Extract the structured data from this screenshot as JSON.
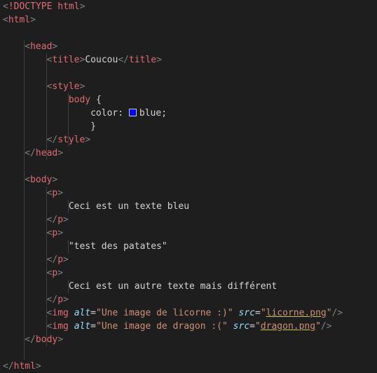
{
  "editor": {
    "lines": [
      {
        "indent": 0,
        "tokens": [
          {
            "t": "<",
            "c": "punct"
          },
          {
            "t": "!DOCTYPE html",
            "c": "red"
          },
          {
            "t": ">",
            "c": "punct"
          }
        ]
      },
      {
        "indent": 0,
        "tokens": [
          {
            "t": "<",
            "c": "punct"
          },
          {
            "t": "html",
            "c": "red"
          },
          {
            "t": ">",
            "c": "punct"
          }
        ]
      },
      {
        "indent": 0,
        "tokens": []
      },
      {
        "indent": 4,
        "tokens": [
          {
            "t": "<",
            "c": "punct"
          },
          {
            "t": "head",
            "c": "red"
          },
          {
            "t": ">",
            "c": "punct"
          }
        ]
      },
      {
        "indent": 8,
        "tokens": [
          {
            "t": "<",
            "c": "punct"
          },
          {
            "t": "title",
            "c": "red"
          },
          {
            "t": ">",
            "c": "punct"
          },
          {
            "t": "Coucou",
            "c": "plain"
          },
          {
            "t": "</",
            "c": "punct"
          },
          {
            "t": "title",
            "c": "red"
          },
          {
            "t": ">",
            "c": "punct"
          }
        ]
      },
      {
        "indent": 0,
        "tokens": []
      },
      {
        "indent": 8,
        "tokens": [
          {
            "t": "<",
            "c": "punct"
          },
          {
            "t": "style",
            "c": "red"
          },
          {
            "t": ">",
            "c": "punct"
          }
        ]
      },
      {
        "indent": 12,
        "tokens": [
          {
            "t": "body",
            "c": "red"
          },
          {
            "t": " {",
            "c": "plain"
          }
        ]
      },
      {
        "indent": 16,
        "tokens": [
          {
            "t": "color",
            "c": "plain"
          },
          {
            "t": ": ",
            "c": "plain"
          },
          {
            "t": "",
            "c": "swatch"
          },
          {
            "t": "blue",
            "c": "plain"
          },
          {
            "t": ";",
            "c": "plain"
          }
        ]
      },
      {
        "indent": 16,
        "tokens": [
          {
            "t": "}",
            "c": "plain"
          }
        ]
      },
      {
        "indent": 8,
        "tokens": [
          {
            "t": "</",
            "c": "punct"
          },
          {
            "t": "style",
            "c": "red"
          },
          {
            "t": ">",
            "c": "punct"
          }
        ]
      },
      {
        "indent": 4,
        "tokens": [
          {
            "t": "</",
            "c": "punct"
          },
          {
            "t": "head",
            "c": "red"
          },
          {
            "t": ">",
            "c": "punct"
          }
        ]
      },
      {
        "indent": 0,
        "tokens": []
      },
      {
        "indent": 4,
        "tokens": [
          {
            "t": "<",
            "c": "punct"
          },
          {
            "t": "body",
            "c": "red"
          },
          {
            "t": ">",
            "c": "punct"
          }
        ]
      },
      {
        "indent": 8,
        "tokens": [
          {
            "t": "<",
            "c": "punct"
          },
          {
            "t": "p",
            "c": "red"
          },
          {
            "t": ">",
            "c": "punct"
          }
        ]
      },
      {
        "indent": 12,
        "tokens": [
          {
            "t": "Ceci est un texte bleu",
            "c": "plain"
          }
        ]
      },
      {
        "indent": 8,
        "tokens": [
          {
            "t": "</",
            "c": "punct"
          },
          {
            "t": "p",
            "c": "red"
          },
          {
            "t": ">",
            "c": "punct"
          }
        ]
      },
      {
        "indent": 8,
        "tokens": [
          {
            "t": "<",
            "c": "punct"
          },
          {
            "t": "p",
            "c": "red"
          },
          {
            "t": ">",
            "c": "punct"
          }
        ]
      },
      {
        "indent": 12,
        "tokens": [
          {
            "t": "\"test des patates\"",
            "c": "plain"
          }
        ]
      },
      {
        "indent": 8,
        "tokens": [
          {
            "t": "</",
            "c": "punct"
          },
          {
            "t": "p",
            "c": "red"
          },
          {
            "t": ">",
            "c": "punct"
          }
        ]
      },
      {
        "indent": 8,
        "tokens": [
          {
            "t": "<",
            "c": "punct"
          },
          {
            "t": "p",
            "c": "red"
          },
          {
            "t": ">",
            "c": "punct"
          }
        ]
      },
      {
        "indent": 12,
        "tokens": [
          {
            "t": "Ceci est un autre texte mais différent",
            "c": "plain"
          }
        ]
      },
      {
        "indent": 8,
        "tokens": [
          {
            "t": "</",
            "c": "punct"
          },
          {
            "t": "p",
            "c": "red"
          },
          {
            "t": ">",
            "c": "punct"
          }
        ]
      },
      {
        "indent": 8,
        "tokens": [
          {
            "t": "<",
            "c": "punct"
          },
          {
            "t": "img",
            "c": "red"
          },
          {
            "t": " ",
            "c": "plain"
          },
          {
            "t": "alt",
            "c": "attr"
          },
          {
            "t": "=",
            "c": "plain"
          },
          {
            "t": "\"Une image de licorne :)\"",
            "c": "str"
          },
          {
            "t": " ",
            "c": "plain"
          },
          {
            "t": "src",
            "c": "attr"
          },
          {
            "t": "=",
            "c": "plain"
          },
          {
            "t": "\"",
            "c": "str"
          },
          {
            "t": "licorne.png",
            "c": "link"
          },
          {
            "t": "\"",
            "c": "str"
          },
          {
            "t": "/>",
            "c": "punct"
          }
        ]
      },
      {
        "indent": 8,
        "tokens": [
          {
            "t": "<",
            "c": "punct"
          },
          {
            "t": "img",
            "c": "red"
          },
          {
            "t": " ",
            "c": "plain"
          },
          {
            "t": "alt",
            "c": "attr"
          },
          {
            "t": "=",
            "c": "plain"
          },
          {
            "t": "\"Une image de dragon :(\"",
            "c": "str"
          },
          {
            "t": " ",
            "c": "plain"
          },
          {
            "t": "src",
            "c": "attr"
          },
          {
            "t": "=",
            "c": "plain"
          },
          {
            "t": "\"",
            "c": "str"
          },
          {
            "t": "dragon.png",
            "c": "link"
          },
          {
            "t": "\"",
            "c": "str"
          },
          {
            "t": "/>",
            "c": "punct"
          }
        ]
      },
      {
        "indent": 4,
        "tokens": [
          {
            "t": "</",
            "c": "punct"
          },
          {
            "t": "body",
            "c": "red"
          },
          {
            "t": ">",
            "c": "punct"
          }
        ]
      },
      {
        "indent": 0,
        "tokens": []
      },
      {
        "indent": 0,
        "tokens": [
          {
            "t": "</",
            "c": "punct"
          },
          {
            "t": "html",
            "c": "red"
          },
          {
            "t": ">",
            "c": "punct"
          }
        ]
      }
    ],
    "colors": {
      "background": "#1e1e1e",
      "tag": "#e06c75",
      "punct": "#808080",
      "attr": "#9cdcfe",
      "string": "#ce9178",
      "text": "#d4d4d4",
      "swatch": "#0000ff"
    }
  }
}
